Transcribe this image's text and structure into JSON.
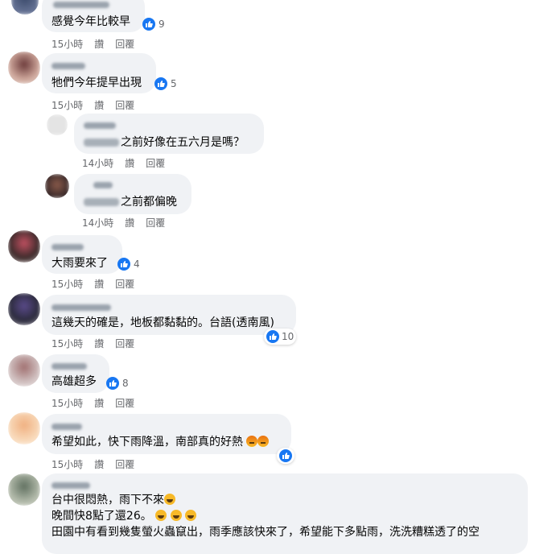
{
  "actions": {
    "like": "讚",
    "reply": "回覆"
  },
  "colors": {
    "bubble": "#f0f2f5",
    "like_blue": "#1877f2",
    "meta_gray": "#65676b"
  },
  "comments": [
    {
      "lines": [
        "感覺今年比較早"
      ],
      "time": "15小時",
      "reactions": "9"
    },
    {
      "lines": [
        "牠們今年提早出現"
      ],
      "time": "15小時",
      "reactions": "5"
    },
    {
      "lines": [
        "之前好像在五六月是嗎？"
      ],
      "time": "14小時",
      "reactions": ""
    },
    {
      "lines": [
        "之前都偏晚"
      ],
      "time": "14小時",
      "reactions": ""
    },
    {
      "lines": [
        "大雨要來了"
      ],
      "time": "15小時",
      "reactions": "4"
    },
    {
      "lines": [
        "這幾天的確是，地板都黏黏的。台語(透南風)"
      ],
      "time": "15小時",
      "reactions": "10"
    },
    {
      "lines": [
        "高雄超多"
      ],
      "time": "15小時",
      "reactions": "8"
    },
    {
      "lines": [
        "希望如此，快下雨降溫，南部真的好熱"
      ],
      "time": "15小時",
      "reactions": ""
    },
    {
      "lines": [
        "台中很悶熱，雨下不來",
        "晚間快8點了還26。",
        "田園中有看到幾隻螢火蟲竄出，雨季應該快來了，希望能下多點雨，洗洗糟糕透了的空"
      ],
      "time": "",
      "reactions": ""
    }
  ]
}
